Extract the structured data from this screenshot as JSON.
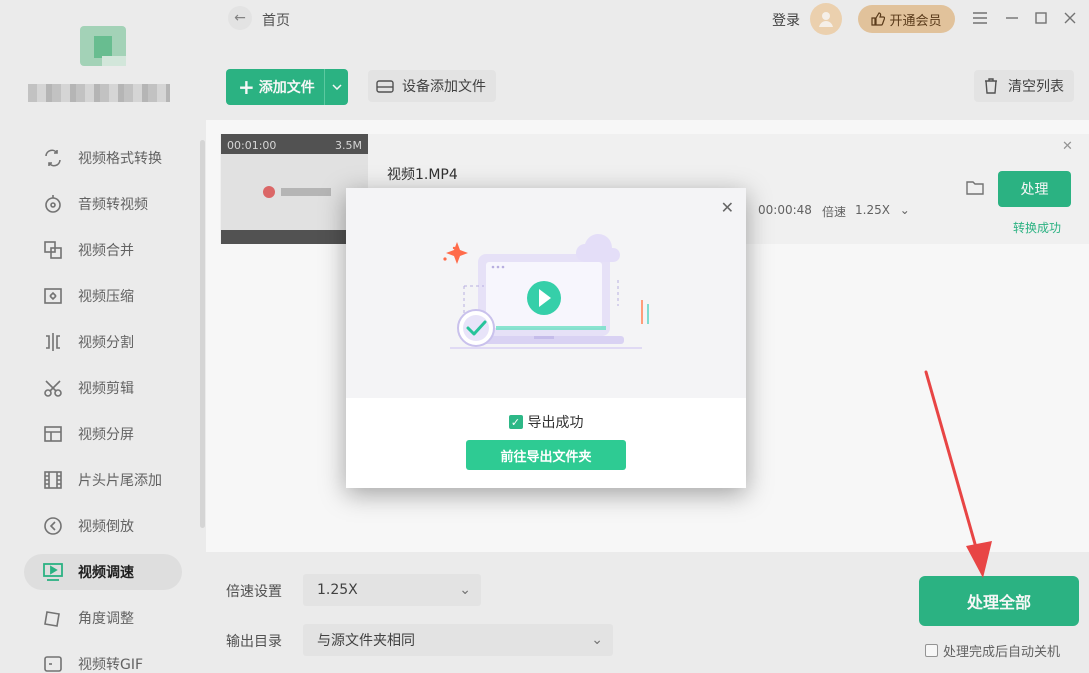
{
  "sidebar": {
    "items": [
      {
        "label": "视频格式转换",
        "icon": "convert-icon"
      },
      {
        "label": "音频转视频",
        "icon": "audio-icon"
      },
      {
        "label": "视频合并",
        "icon": "merge-icon"
      },
      {
        "label": "视频压缩",
        "icon": "compress-icon"
      },
      {
        "label": "视频分割",
        "icon": "split-icon"
      },
      {
        "label": "视频剪辑",
        "icon": "scissors-icon"
      },
      {
        "label": "视频分屏",
        "icon": "splitscreen-icon"
      },
      {
        "label": "片头片尾添加",
        "icon": "film-icon"
      },
      {
        "label": "视频倒放",
        "icon": "reverse-icon"
      },
      {
        "label": "视频调速",
        "icon": "speed-icon",
        "active": true
      },
      {
        "label": "角度调整",
        "icon": "rotate-icon"
      },
      {
        "label": "视频转GIF",
        "icon": "gif-icon"
      }
    ]
  },
  "topbar": {
    "breadcrumb": "首页",
    "login": "登录",
    "vip": "开通会员"
  },
  "toolbar": {
    "add_file": "添加文件",
    "device_add": "设备添加文件",
    "clear_list": "清空列表"
  },
  "file": {
    "duration_thumb": "00:01:00",
    "size_thumb": "3.5M",
    "name": "视频1.MP4",
    "out_duration": "00:00:48",
    "speed_label": "倍速",
    "speed_value": "1.25X",
    "process": "处理",
    "status": "转换成功"
  },
  "modal": {
    "success": "导出成功",
    "open_folder": "前往导出文件夹"
  },
  "settings": {
    "speed_label": "倍速设置",
    "speed_value": "1.25X",
    "output_label": "输出目录",
    "output_value": "与源文件夹相同"
  },
  "actions": {
    "process_all": "处理全部",
    "auto_shutdown": "处理完成后自动关机"
  },
  "colors": {
    "accent": "#2db887",
    "vip_bg": "#e9c9a0",
    "annotation_arrow": "#f04848"
  }
}
